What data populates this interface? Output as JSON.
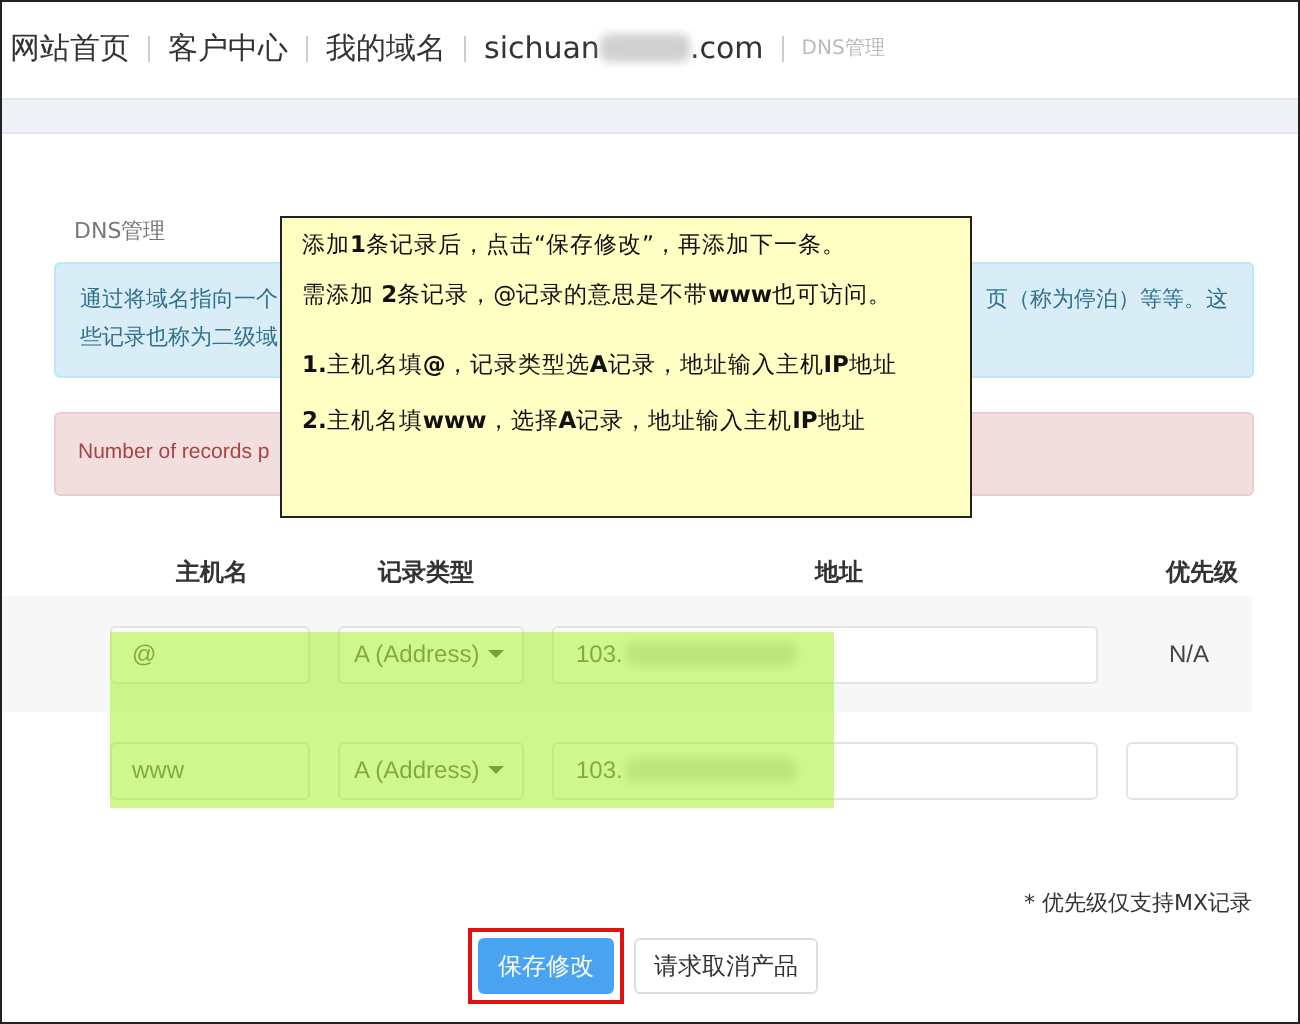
{
  "breadcrumb": [
    {
      "label": "网站首页",
      "kind": "link"
    },
    {
      "label": "客户中心",
      "kind": "link"
    },
    {
      "label": "我的域名",
      "kind": "link"
    },
    {
      "label": "sichuan",
      "suffix": ".com",
      "kind": "domain"
    },
    {
      "label": "DNS管理",
      "kind": "current"
    }
  ],
  "section_title": "DNS管理",
  "info_box": {
    "line_1_left": "通过将域名指向一个",
    "line_1_right": "页（称为停泊）等等。这",
    "line_2": "些记录也称为二级域"
  },
  "alert": "Number of records p",
  "note": [
    "添加**1**条记录后，点击“保存修改”，再添加下一条。",
    "需添加 **2**条记录，@记录的意思是不带**www**也可访问。",
    "**1.**主机名填**@**，记录类型选**A**记录，地址输入主机**IP**地址",
    "**2.**主机名填**www**，选择**A**记录，地址输入主机**IP**地址"
  ],
  "table": {
    "columns": [
      "主机名",
      "记录类型",
      "地址",
      "优先级"
    ],
    "rows": [
      {
        "host": "@",
        "type": "A (Address)",
        "address": "103.",
        "priority": {
          "kind": "text",
          "text": "N/A"
        }
      },
      {
        "host": "www",
        "type": "A (Address)",
        "address": "103.",
        "priority": {
          "kind": "input"
        }
      }
    ]
  },
  "footnote": "* 优先级仅支持MX记录",
  "buttons": [
    {
      "label": "保存修改",
      "kind": "primary",
      "highlighted": true
    },
    {
      "label": "请求取消产品",
      "kind": "default",
      "highlighted": false
    }
  ]
}
